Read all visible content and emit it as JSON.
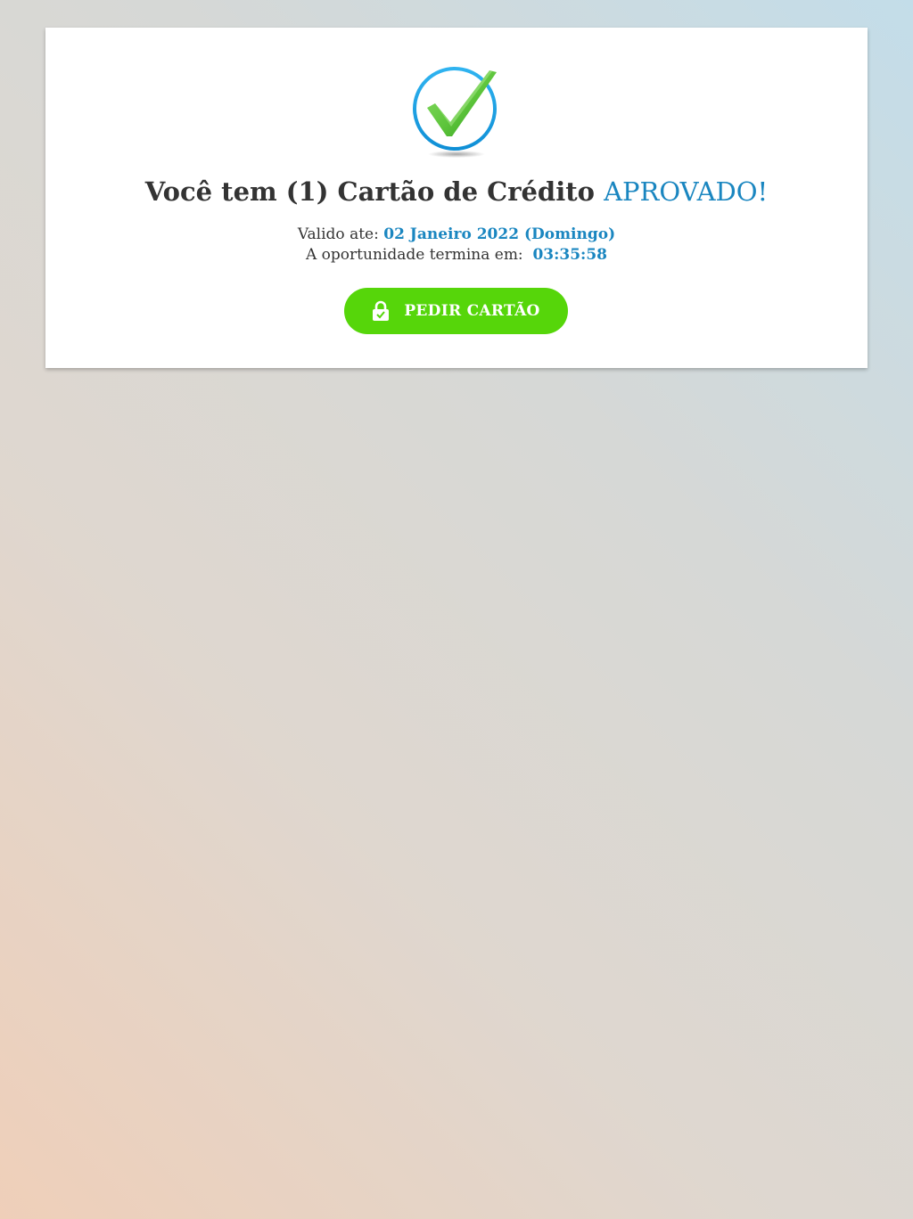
{
  "card": {
    "headline_main": "Você tem (1) Cartão de Crédito ",
    "headline_accent": "APROVADO!",
    "valid_label": "Valido ate: ",
    "valid_date": "02 Janeiro 2022 (Domingo)",
    "timer_label": "A oportunidade termina em:  ",
    "timer_value": "03:35:58",
    "cta_label": "PEDIR CARTÃO"
  },
  "icons": {
    "approval": "checkmark-circle-icon",
    "cta": "lock-icon"
  },
  "colors": {
    "accent": "#1a86c0",
    "cta": "#56d60a",
    "check_green": "#5cc43a",
    "circle_blue": "#1da1e6"
  }
}
